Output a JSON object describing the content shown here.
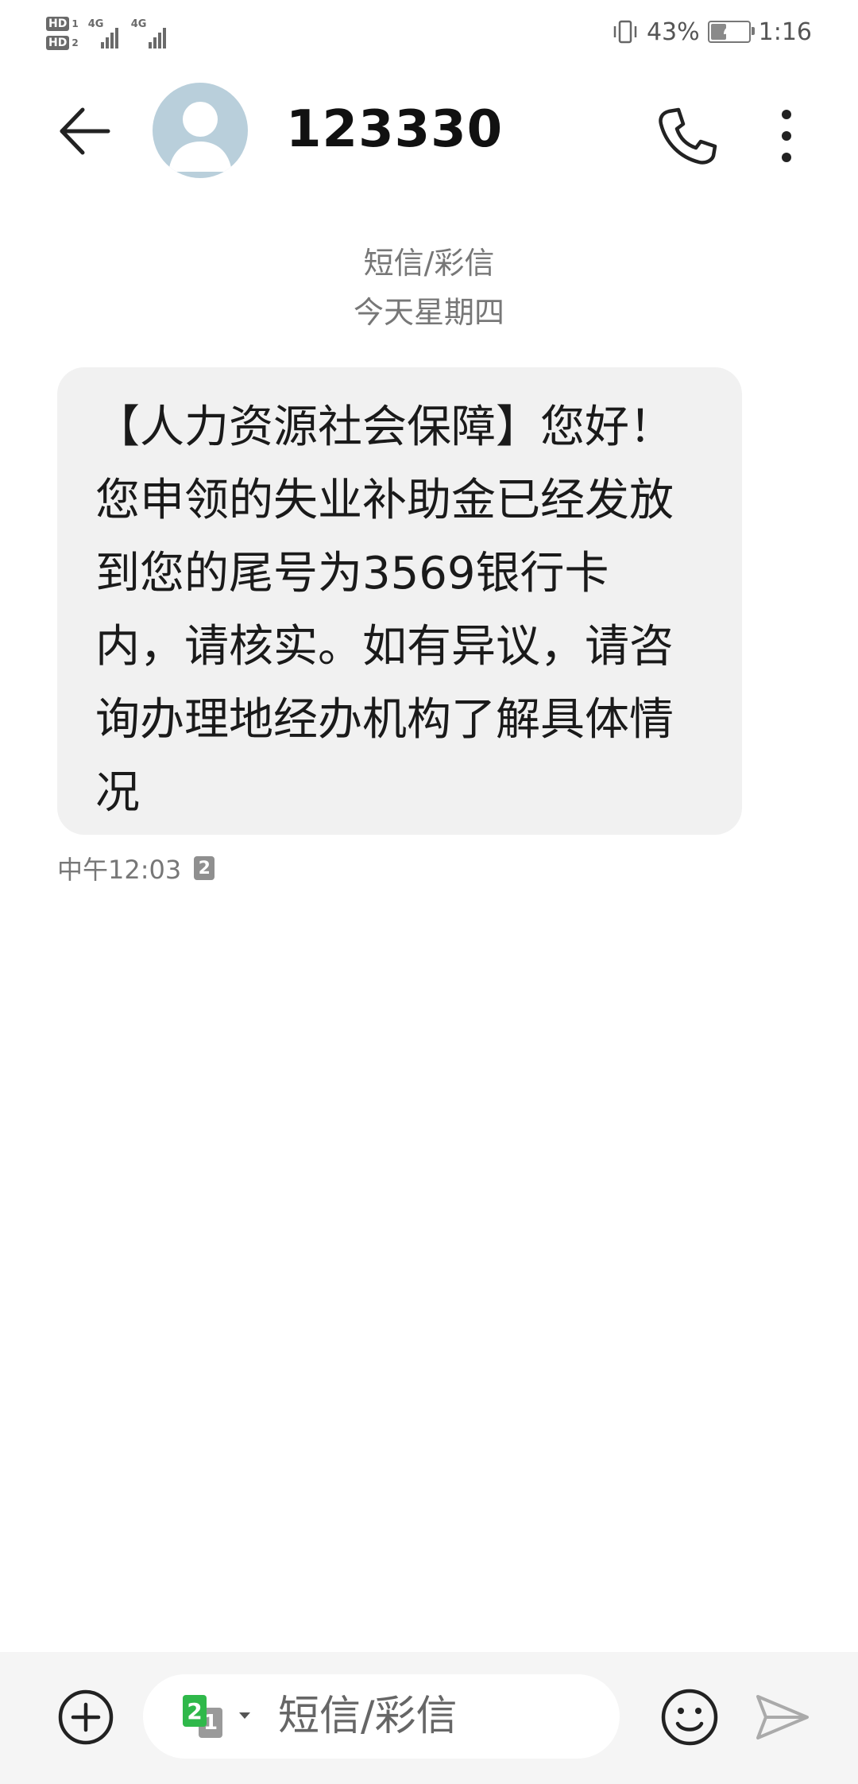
{
  "status_bar": {
    "sim1_badge": "HD",
    "sim1_index": "1",
    "sim2_badge": "HD",
    "sim2_index": "2",
    "network1": "4G",
    "network2": "4G",
    "battery_percent": "43%",
    "battery_level": 0.43,
    "time": "1:16"
  },
  "header": {
    "contact_name": "123330",
    "icons": [
      "back-arrow-icon",
      "avatar-icon",
      "phone-icon",
      "more-vertical-icon"
    ]
  },
  "conversation": {
    "channel_label": "短信/彩信",
    "date_label": "今天星期四",
    "messages": [
      {
        "text": "【人力资源社会保障】您好！您申领的失业补助金已经发放到您的尾号为3569银行卡内，请核实。如有异议，请咨询办理地经办机构了解具体情况",
        "time": "中午12:03",
        "sim": "2"
      }
    ]
  },
  "compose": {
    "placeholder": "短信/彩信",
    "sim_primary": "2",
    "sim_secondary": "1",
    "icons": [
      "add-circle-icon",
      "sim-selector-icon",
      "emoji-icon",
      "send-icon"
    ]
  },
  "colors": {
    "bubble_bg": "#f1f1f1",
    "compose_bg": "#f5f5f5",
    "avatar_bg": "#b9cfdb",
    "sim_green": "#2fb84a"
  }
}
